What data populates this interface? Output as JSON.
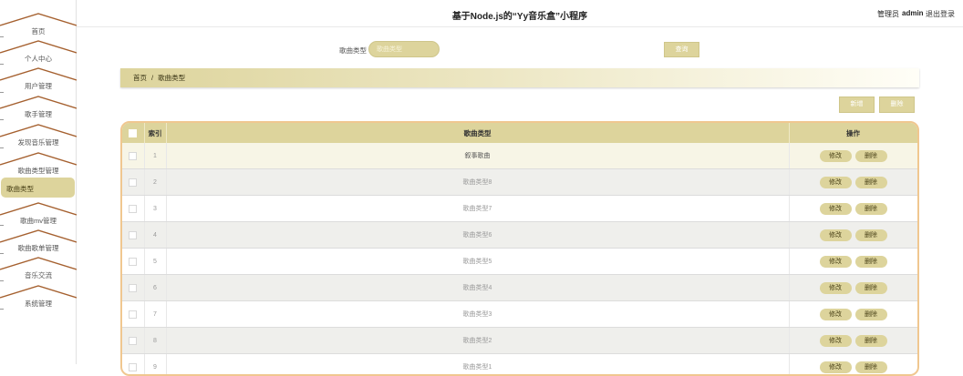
{
  "header": {
    "title": "基于Node.js的“Yy音乐盒”小程序",
    "role": "管理员",
    "username": "admin",
    "logout": "退出登录"
  },
  "sidebar": {
    "items": [
      {
        "label": "首页"
      },
      {
        "label": "个人中心"
      },
      {
        "label": "用户管理"
      },
      {
        "label": "歌手管理"
      },
      {
        "label": "发现音乐管理"
      },
      {
        "label": "歌曲类型管理"
      },
      {
        "label": "歌曲类型",
        "active": true
      },
      {
        "label": "歌曲mv管理"
      },
      {
        "label": "歌曲歌单管理"
      },
      {
        "label": "音乐交流"
      },
      {
        "label": "系统管理"
      }
    ]
  },
  "search": {
    "label": "歌曲类型",
    "placeholder": "歌曲类型",
    "query_button": "查询"
  },
  "breadcrumb": {
    "home": "首页",
    "separator": "/",
    "current": "歌曲类型"
  },
  "actions": {
    "add": "新增",
    "delete": "删除"
  },
  "table": {
    "columns": [
      "索引",
      "歌曲类型",
      "操作"
    ],
    "rows": [
      {
        "index": "1",
        "type": "叙事歌曲"
      },
      {
        "index": "2",
        "type": "歌曲类型8"
      },
      {
        "index": "3",
        "type": "歌曲类型7"
      },
      {
        "index": "4",
        "type": "歌曲类型6"
      },
      {
        "index": "5",
        "type": "歌曲类型5"
      },
      {
        "index": "6",
        "type": "歌曲类型4"
      },
      {
        "index": "7",
        "type": "歌曲类型3"
      },
      {
        "index": "8",
        "type": "歌曲类型2"
      },
      {
        "index": "9",
        "type": "歌曲类型1"
      }
    ],
    "edit_label": "修改",
    "delete_label": "删除"
  },
  "colors": {
    "accent": "#ddd49c",
    "roof": "#a5602f",
    "table_border": "#f0c790"
  }
}
